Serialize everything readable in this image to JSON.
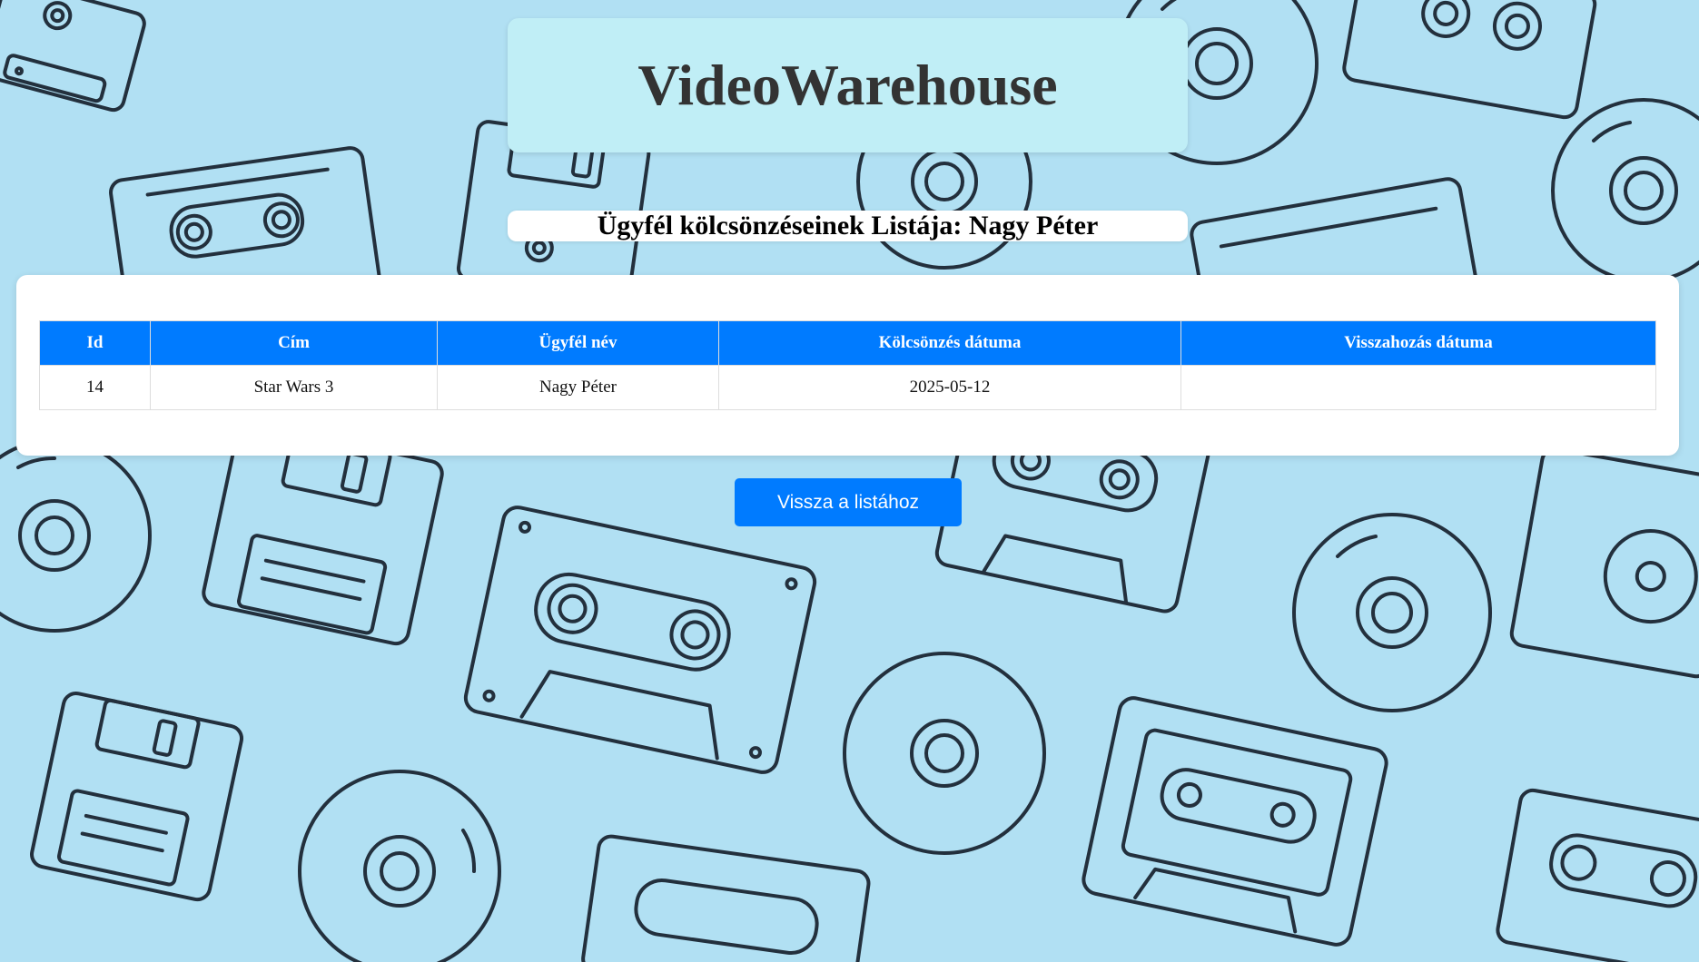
{
  "header": {
    "title": "VideoWarehouse"
  },
  "subtitle": {
    "text": "Ügyfél kölcsönzéseinek Listája: Nagy Péter"
  },
  "table": {
    "columns": [
      "Id",
      "Cím",
      "Ügyfél név",
      "Kölcsönzés dátuma",
      "Visszahozás dátuma"
    ],
    "rows": [
      {
        "id": "14",
        "title": "Star Wars 3",
        "customer": "Nagy Péter",
        "rented_on": "2025-05-12",
        "returned_on": ""
      }
    ]
  },
  "actions": {
    "back_label": "Vissza a listához"
  },
  "colors": {
    "accent": "#007bff",
    "background": "#b1e0f3",
    "header_card": "#c0eef6",
    "pattern_stroke": "#23303d"
  },
  "background_pattern": {
    "icons": [
      "cassette-icon",
      "floppy-disk-icon",
      "cd-disc-icon"
    ]
  }
}
